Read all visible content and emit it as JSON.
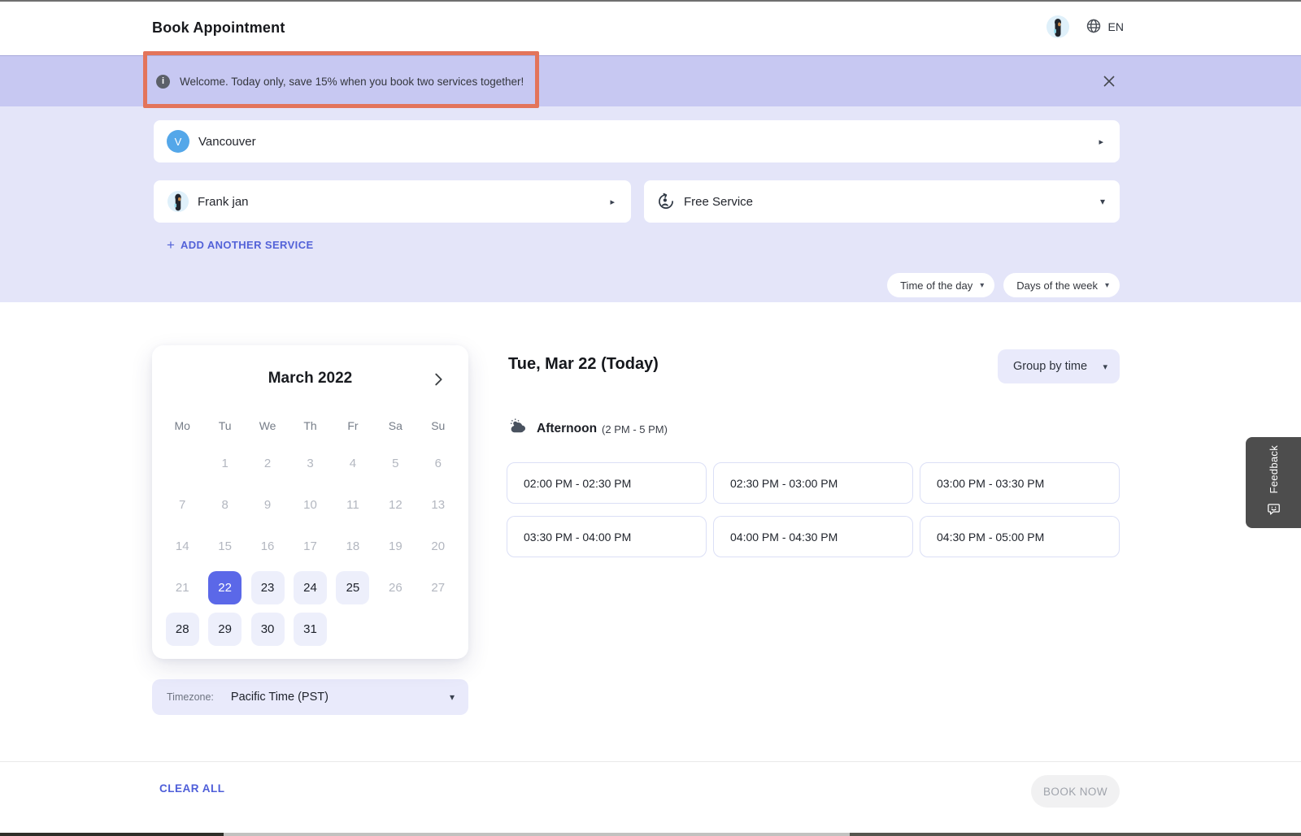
{
  "header": {
    "title": "Book Appointment",
    "language": "EN"
  },
  "banner": {
    "message": "Welcome. Today only, save 15% when you book two services together!"
  },
  "booking": {
    "location": {
      "initial": "V",
      "name": "Vancouver"
    },
    "staff": {
      "name": "Frank jan"
    },
    "service": {
      "name": "Free Service"
    },
    "add_service_label": "ADD ANOTHER SERVICE",
    "filters": [
      {
        "label": "Time of the day"
      },
      {
        "label": "Days of the week"
      }
    ]
  },
  "calendar": {
    "month_label": "March 2022",
    "day_headers": [
      "Mo",
      "Tu",
      "We",
      "Th",
      "Fr",
      "Sa",
      "Su"
    ],
    "weeks": [
      [
        {
          "d": "",
          "s": "empty"
        },
        {
          "d": "1",
          "s": "muted"
        },
        {
          "d": "2",
          "s": "muted"
        },
        {
          "d": "3",
          "s": "muted"
        },
        {
          "d": "4",
          "s": "muted"
        },
        {
          "d": "5",
          "s": "muted"
        },
        {
          "d": "6",
          "s": "muted"
        }
      ],
      [
        {
          "d": "7",
          "s": "muted"
        },
        {
          "d": "8",
          "s": "muted"
        },
        {
          "d": "9",
          "s": "muted"
        },
        {
          "d": "10",
          "s": "muted"
        },
        {
          "d": "11",
          "s": "muted"
        },
        {
          "d": "12",
          "s": "muted"
        },
        {
          "d": "13",
          "s": "muted"
        }
      ],
      [
        {
          "d": "14",
          "s": "muted"
        },
        {
          "d": "15",
          "s": "muted"
        },
        {
          "d": "16",
          "s": "muted"
        },
        {
          "d": "17",
          "s": "muted"
        },
        {
          "d": "18",
          "s": "muted"
        },
        {
          "d": "19",
          "s": "muted"
        },
        {
          "d": "20",
          "s": "muted"
        }
      ],
      [
        {
          "d": "21",
          "s": "muted"
        },
        {
          "d": "22",
          "s": "selected"
        },
        {
          "d": "23",
          "s": "open"
        },
        {
          "d": "24",
          "s": "open"
        },
        {
          "d": "25",
          "s": "open"
        },
        {
          "d": "26",
          "s": "muted"
        },
        {
          "d": "27",
          "s": "muted"
        }
      ],
      [
        {
          "d": "28",
          "s": "open"
        },
        {
          "d": "29",
          "s": "open"
        },
        {
          "d": "30",
          "s": "open"
        },
        {
          "d": "31",
          "s": "open"
        },
        {
          "d": "",
          "s": "empty"
        },
        {
          "d": "",
          "s": "empty"
        },
        {
          "d": "",
          "s": "empty"
        }
      ]
    ],
    "timezone": {
      "label": "Timezone:",
      "value": "Pacific Time (PST)"
    }
  },
  "schedule": {
    "date_heading": "Tue, Mar 22 (Today)",
    "group_by_label": "Group by time",
    "period_name": "Afternoon",
    "period_range": "(2 PM - 5 PM)",
    "slots": [
      "02:00 PM - 02:30 PM",
      "02:30 PM - 03:00 PM",
      "03:00 PM - 03:30 PM",
      "03:30 PM - 04:00 PM",
      "04:00 PM - 04:30 PM",
      "04:30 PM - 05:00 PM"
    ]
  },
  "feedback": {
    "label": "Feedback"
  },
  "footer": {
    "clear_label": "CLEAR ALL",
    "book_label": "BOOK NOW"
  },
  "colors": {
    "accent": "#5362d8",
    "selected_day_bg": "#5b68e8",
    "banner_bg": "#c7c8f2",
    "section_bg": "#e4e5f9",
    "annotation_highlight": "#e3745b",
    "feedback_tab_bg": "#4d4d4d"
  }
}
